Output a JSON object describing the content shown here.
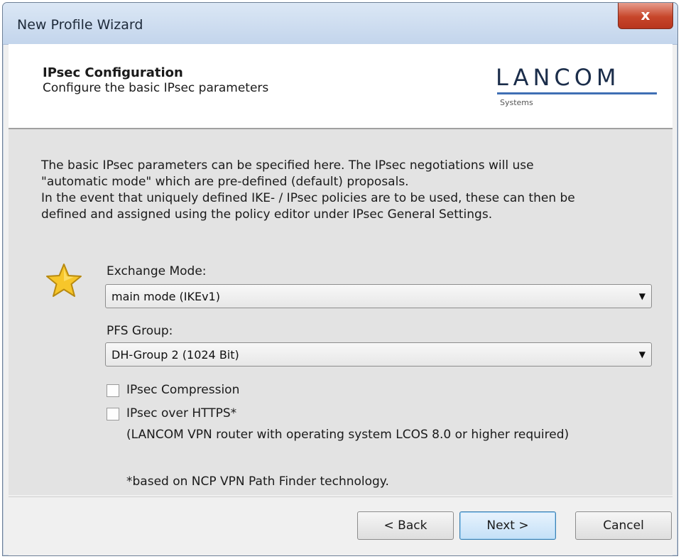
{
  "window": {
    "title": "New Profile Wizard",
    "close_glyph": "x"
  },
  "header": {
    "title": "IPsec Configuration",
    "subtitle": "Configure the basic IPsec parameters",
    "logo_text": "LANCOM",
    "logo_subtext": "Systems",
    "logo_accent": "#3f6fb4"
  },
  "description": [
    "The basic IPsec parameters can be specified here. The IPsec negotiations will use",
    "\"automatic mode\" which are pre-defined (default) proposals.",
    "In the event that uniquely defined IKE- / IPsec policies are to be used, these can then be",
    "defined and assigned using the policy editor under IPsec General Settings."
  ],
  "icon": "star-icon",
  "exchange_mode": {
    "label": "Exchange Mode:",
    "value": "main mode (IKEv1)"
  },
  "pfs_group": {
    "label": "PFS Group:",
    "value": "DH-Group 2 (1024 Bit)"
  },
  "ipsec_compression": {
    "label": "IPsec Compression",
    "checked": false
  },
  "ipsec_over_https": {
    "label": "IPsec over HTTPS*",
    "checked": false,
    "note": "(LANCOM VPN router with operating system LCOS 8.0 or higher required)"
  },
  "footnote": "*based on NCP VPN Path Finder technology.",
  "buttons": {
    "back": "< Back",
    "next": "Next >",
    "cancel": "Cancel"
  }
}
